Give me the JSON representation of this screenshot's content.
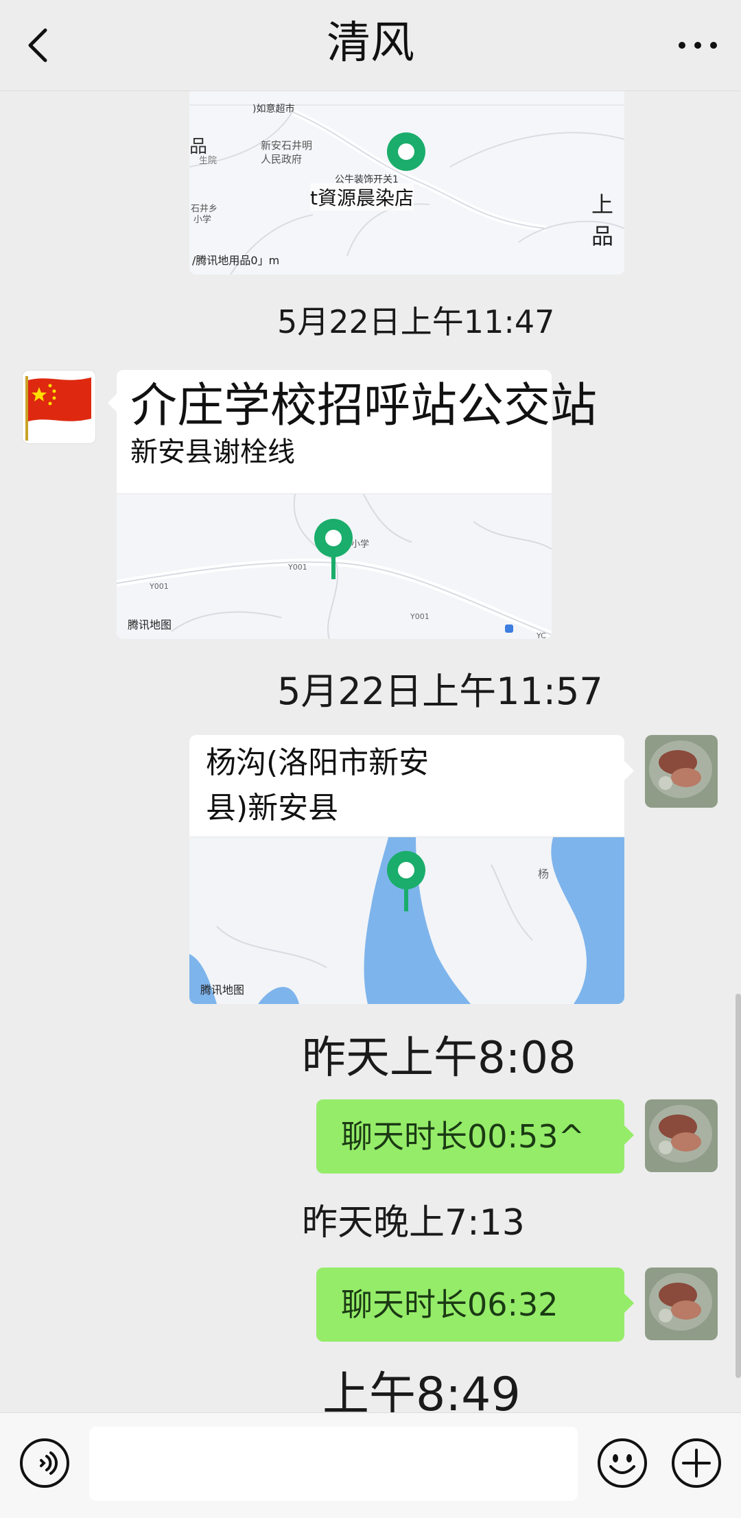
{
  "header": {
    "title": "清风"
  },
  "messages": {
    "map1": {
      "labels": {
        "supermarket": ")如意超市",
        "gov": "新安石井明",
        "gov2": "人民政府",
        "shop_small": "公牛装饰开关1",
        "shop": "t資源晨染店",
        "pin_right": "上品",
        "left_a": "品",
        "left_b": "生院",
        "school_a": "​石井乡",
        "school_b": "​小学"
      },
      "caption": "/腾讯地用品0」m"
    },
    "time1": "5月22日上午11:47",
    "map2": {
      "title": "介庄学校招呼站公交站",
      "subtitle": "新安县谢栓线",
      "road1": "Y001",
      "road2": "Y001",
      "road3": "Y001",
      "road4": "YC",
      "school": "小学",
      "caption": "腾讯地图"
    },
    "time2": "5月22日上午11:57",
    "map3": {
      "title_line1": "杨沟(洛阳市新安",
      "title_line2": "县)新安县",
      "town": "杨",
      "caption": "腾讯地图"
    },
    "time3": "昨天上午8:08",
    "call1": "聊天时长00:53^",
    "time4": "昨天晚上7:13",
    "call2": "聊天时长06:32",
    "time5": "上午8:49"
  },
  "colors": {
    "bubble_green": "#95ec69",
    "pin_green": "#1aad6b",
    "water": "#7eb4ec"
  },
  "icons": [
    "back-chevron-icon",
    "more-dots-icon",
    "voice-icon",
    "emoji-icon",
    "plus-icon",
    "map-pin-icon",
    "china-flag-icon"
  ]
}
